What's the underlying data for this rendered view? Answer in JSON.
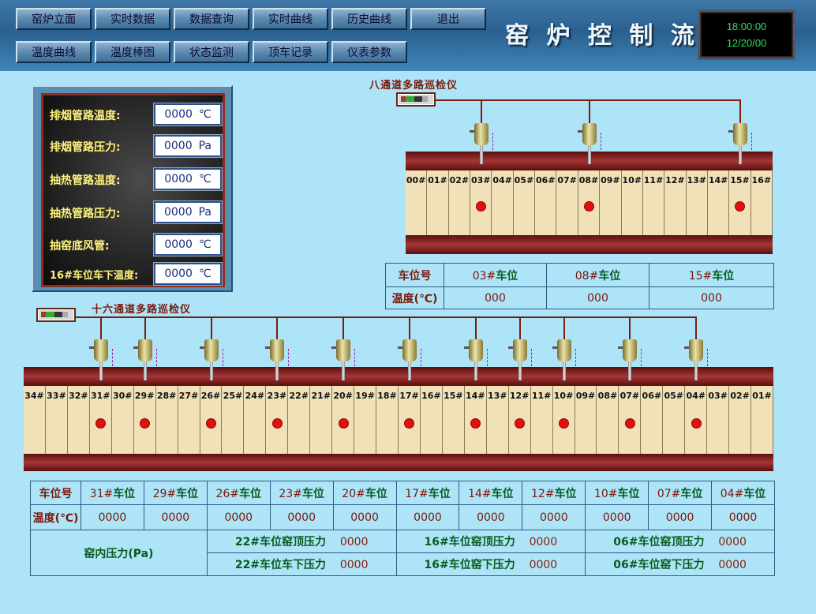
{
  "header": {
    "title": "窑 炉 控 制 流 程",
    "nav_row1": [
      "窑炉立面",
      "实时数据",
      "数据查询",
      "实时曲线",
      "历史曲线",
      "退出"
    ],
    "nav_row2": [
      "温度曲线",
      "温度棒图",
      "状态监测",
      "顶车记录",
      "仪表参数"
    ],
    "clock_time": "18:00:00",
    "clock_date": "12/20/00"
  },
  "info_panel": {
    "rows": [
      {
        "label": "排烟管路温度:",
        "value": "0000",
        "unit": "℃"
      },
      {
        "label": "排烟管路压力:",
        "value": "0000",
        "unit": "Pa"
      },
      {
        "label": "抽热管路温度:",
        "value": "0000",
        "unit": "℃"
      },
      {
        "label": "抽热管路压力:",
        "value": "0000",
        "unit": "Pa"
      },
      {
        "label": "抽窑底风管:",
        "value": "0000",
        "unit": "℃"
      },
      {
        "label": "16#车位车下温度:",
        "value": "0000",
        "unit": "℃"
      }
    ]
  },
  "kiln_top": {
    "title": "八通道多路巡检仪",
    "slots": [
      "00#",
      "01#",
      "02#",
      "03#",
      "04#",
      "05#",
      "06#",
      "07#",
      "08#",
      "09#",
      "10#",
      "11#",
      "12#",
      "13#",
      "14#",
      "15#",
      "16#"
    ],
    "sensor_slots": [
      "03#",
      "08#",
      "15#"
    ]
  },
  "table_top": {
    "row1_label": "车位号",
    "row2_label": "温度(℃)",
    "columns": [
      "03#车位",
      "08#车位",
      "15#车位"
    ],
    "values": [
      "000",
      "000",
      "000"
    ]
  },
  "kiln_bottom": {
    "title": "十六通道多路巡检仪",
    "slots": [
      "34#",
      "33#",
      "32#",
      "31#",
      "30#",
      "29#",
      "28#",
      "27#",
      "26#",
      "25#",
      "24#",
      "23#",
      "22#",
      "21#",
      "20#",
      "19#",
      "18#",
      "17#",
      "16#",
      "15#",
      "14#",
      "13#",
      "12#",
      "11#",
      "10#",
      "09#",
      "08#",
      "07#",
      "06#",
      "05#",
      "04#",
      "03#",
      "02#",
      "01#"
    ],
    "sensor_slots": [
      "31#",
      "29#",
      "26#",
      "23#",
      "20#",
      "17#",
      "14#",
      "12#",
      "10#",
      "07#",
      "04#"
    ]
  },
  "table_bottom": {
    "row1_label": "车位号",
    "row2_label": "温度(℃)",
    "columns": [
      "31#车位",
      "29#车位",
      "26#车位",
      "23#车位",
      "20#车位",
      "17#车位",
      "14#车位",
      "12#车位",
      "10#车位",
      "07#车位",
      "04#车位"
    ],
    "values": [
      "0000",
      "0000",
      "0000",
      "0000",
      "0000",
      "0000",
      "0000",
      "0000",
      "0000",
      "0000",
      "0000"
    ],
    "pressure_label": "窑内压力(Pa)",
    "pressure_rows": [
      [
        {
          "label": "22#车位窑顶压力",
          "value": "0000"
        },
        {
          "label": "16#车位窑顶压力",
          "value": "0000"
        },
        {
          "label": "06#车位窑顶压力",
          "value": "0000"
        }
      ],
      [
        {
          "label": "22#车位车下压力",
          "value": "0000"
        },
        {
          "label": "16#车位窑下压力",
          "value": "0000"
        },
        {
          "label": "06#车位窑下压力",
          "value": "0000"
        }
      ]
    ]
  }
}
